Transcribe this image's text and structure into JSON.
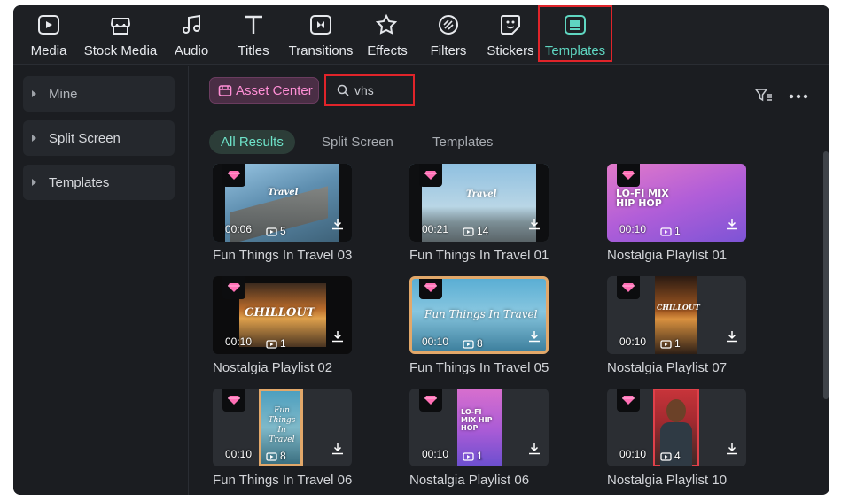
{
  "toolbar": {
    "items": [
      {
        "label": "Media",
        "icon": "media-icon"
      },
      {
        "label": "Stock Media",
        "icon": "stock-media-icon"
      },
      {
        "label": "Audio",
        "icon": "audio-icon"
      },
      {
        "label": "Titles",
        "icon": "titles-icon"
      },
      {
        "label": "Transitions",
        "icon": "transitions-icon"
      },
      {
        "label": "Effects",
        "icon": "effects-icon"
      },
      {
        "label": "Filters",
        "icon": "filters-icon"
      },
      {
        "label": "Stickers",
        "icon": "stickers-icon"
      },
      {
        "label": "Templates",
        "icon": "templates-icon"
      }
    ],
    "active": "Templates"
  },
  "sidebar": {
    "items": [
      {
        "label": "Mine"
      },
      {
        "label": "Split Screen"
      },
      {
        "label": "Templates"
      }
    ]
  },
  "asset_center": {
    "label": "Asset Center"
  },
  "search": {
    "value": "vhs",
    "placeholder": ""
  },
  "tabs": [
    {
      "label": "All Results"
    },
    {
      "label": "Split Screen"
    },
    {
      "label": "Templates"
    }
  ],
  "cards": [
    {
      "title": "Fun Things In Travel 03",
      "duration": "00:06",
      "scenes": "5",
      "overlay": "Travel"
    },
    {
      "title": "Fun Things In Travel 01",
      "duration": "00:21",
      "scenes": "14",
      "overlay": "Travel"
    },
    {
      "title": "Nostalgia Playlist 01",
      "duration": "00:10",
      "scenes": "1",
      "overlay": "LO-FI MIX HIP HOP"
    },
    {
      "title": "Nostalgia Playlist 02",
      "duration": "00:10",
      "scenes": "1",
      "overlay": "CHILLOUT"
    },
    {
      "title": "Fun Things In Travel 05",
      "duration": "00:10",
      "scenes": "8",
      "overlay": "Fun Things In Travel"
    },
    {
      "title": "Nostalgia Playlist 07",
      "duration": "00:10",
      "scenes": "1",
      "overlay": "CHILLOUT"
    },
    {
      "title": "Fun Things In Travel 06",
      "duration": "00:10",
      "scenes": "8",
      "overlay": "Fun Things In Travel"
    },
    {
      "title": "Nostalgia Playlist 06",
      "duration": "00:10",
      "scenes": "1",
      "overlay": "LO-FI MIX HIP HOP"
    },
    {
      "title": "Nostalgia Playlist 10",
      "duration": "00:10",
      "scenes": "4",
      "overlay": ""
    }
  ],
  "colors": {
    "accent": "#5fd6c1",
    "highlight_frame": "#e0242a",
    "asset_center_text": "#ff8fd6"
  }
}
